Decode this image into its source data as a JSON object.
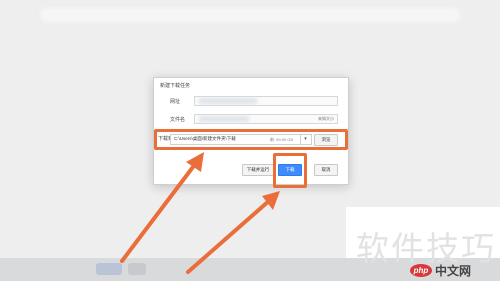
{
  "dialog": {
    "title": "新建下载任务",
    "url_label": "网址",
    "filename_label": "文件名",
    "size_text": "未知大小",
    "download_to_label": "下载到：",
    "path_value": "C:\\Users\\桌面\\新建文件夹\\下载",
    "free_space": "剩: 99.89 GB",
    "dropdown_glyph": "▾",
    "browse_label": "浏览",
    "buttons": {
      "download_and_open": "下载并运行",
      "download": "下载",
      "cancel": "取消"
    }
  },
  "watermark": {
    "title": "软件技巧",
    "php_badge": "php",
    "site": "中文网"
  },
  "colors": {
    "highlight": "#ea6e3a",
    "primary_button": "#3d8bfd",
    "dialog_bg": "#ffffff",
    "page_bg": "#eeeeee"
  }
}
